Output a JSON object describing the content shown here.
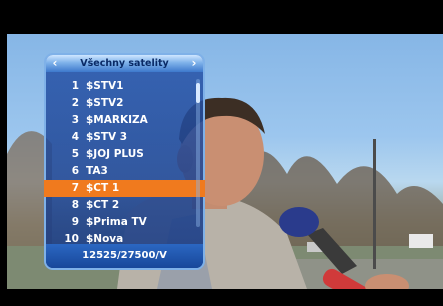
{
  "satellite_list": {
    "title": "Všechny satelity",
    "nav_left_icon": "chevron-left-icon",
    "nav_right_icon": "chevron-right-icon",
    "channels": [
      {
        "number": "1",
        "name": "$STV1"
      },
      {
        "number": "2",
        "name": "$STV2"
      },
      {
        "number": "3",
        "name": "$MARKIZA"
      },
      {
        "number": "4",
        "name": "$STV 3"
      },
      {
        "number": "5",
        "name": "$JOJ PLUS"
      },
      {
        "number": "6",
        "name": "TA3"
      },
      {
        "number": "7",
        "name": "$CT 1"
      },
      {
        "number": "8",
        "name": "$CT 2"
      },
      {
        "number": "9",
        "name": "$Prima TV"
      },
      {
        "number": "10",
        "name": "$Nova"
      }
    ],
    "selected_index": 6,
    "transponder": "12525/27500/V"
  },
  "colors": {
    "panel": "#2355aa",
    "selected_row": "#f07a1e",
    "header_light": "#cfe6ff"
  }
}
